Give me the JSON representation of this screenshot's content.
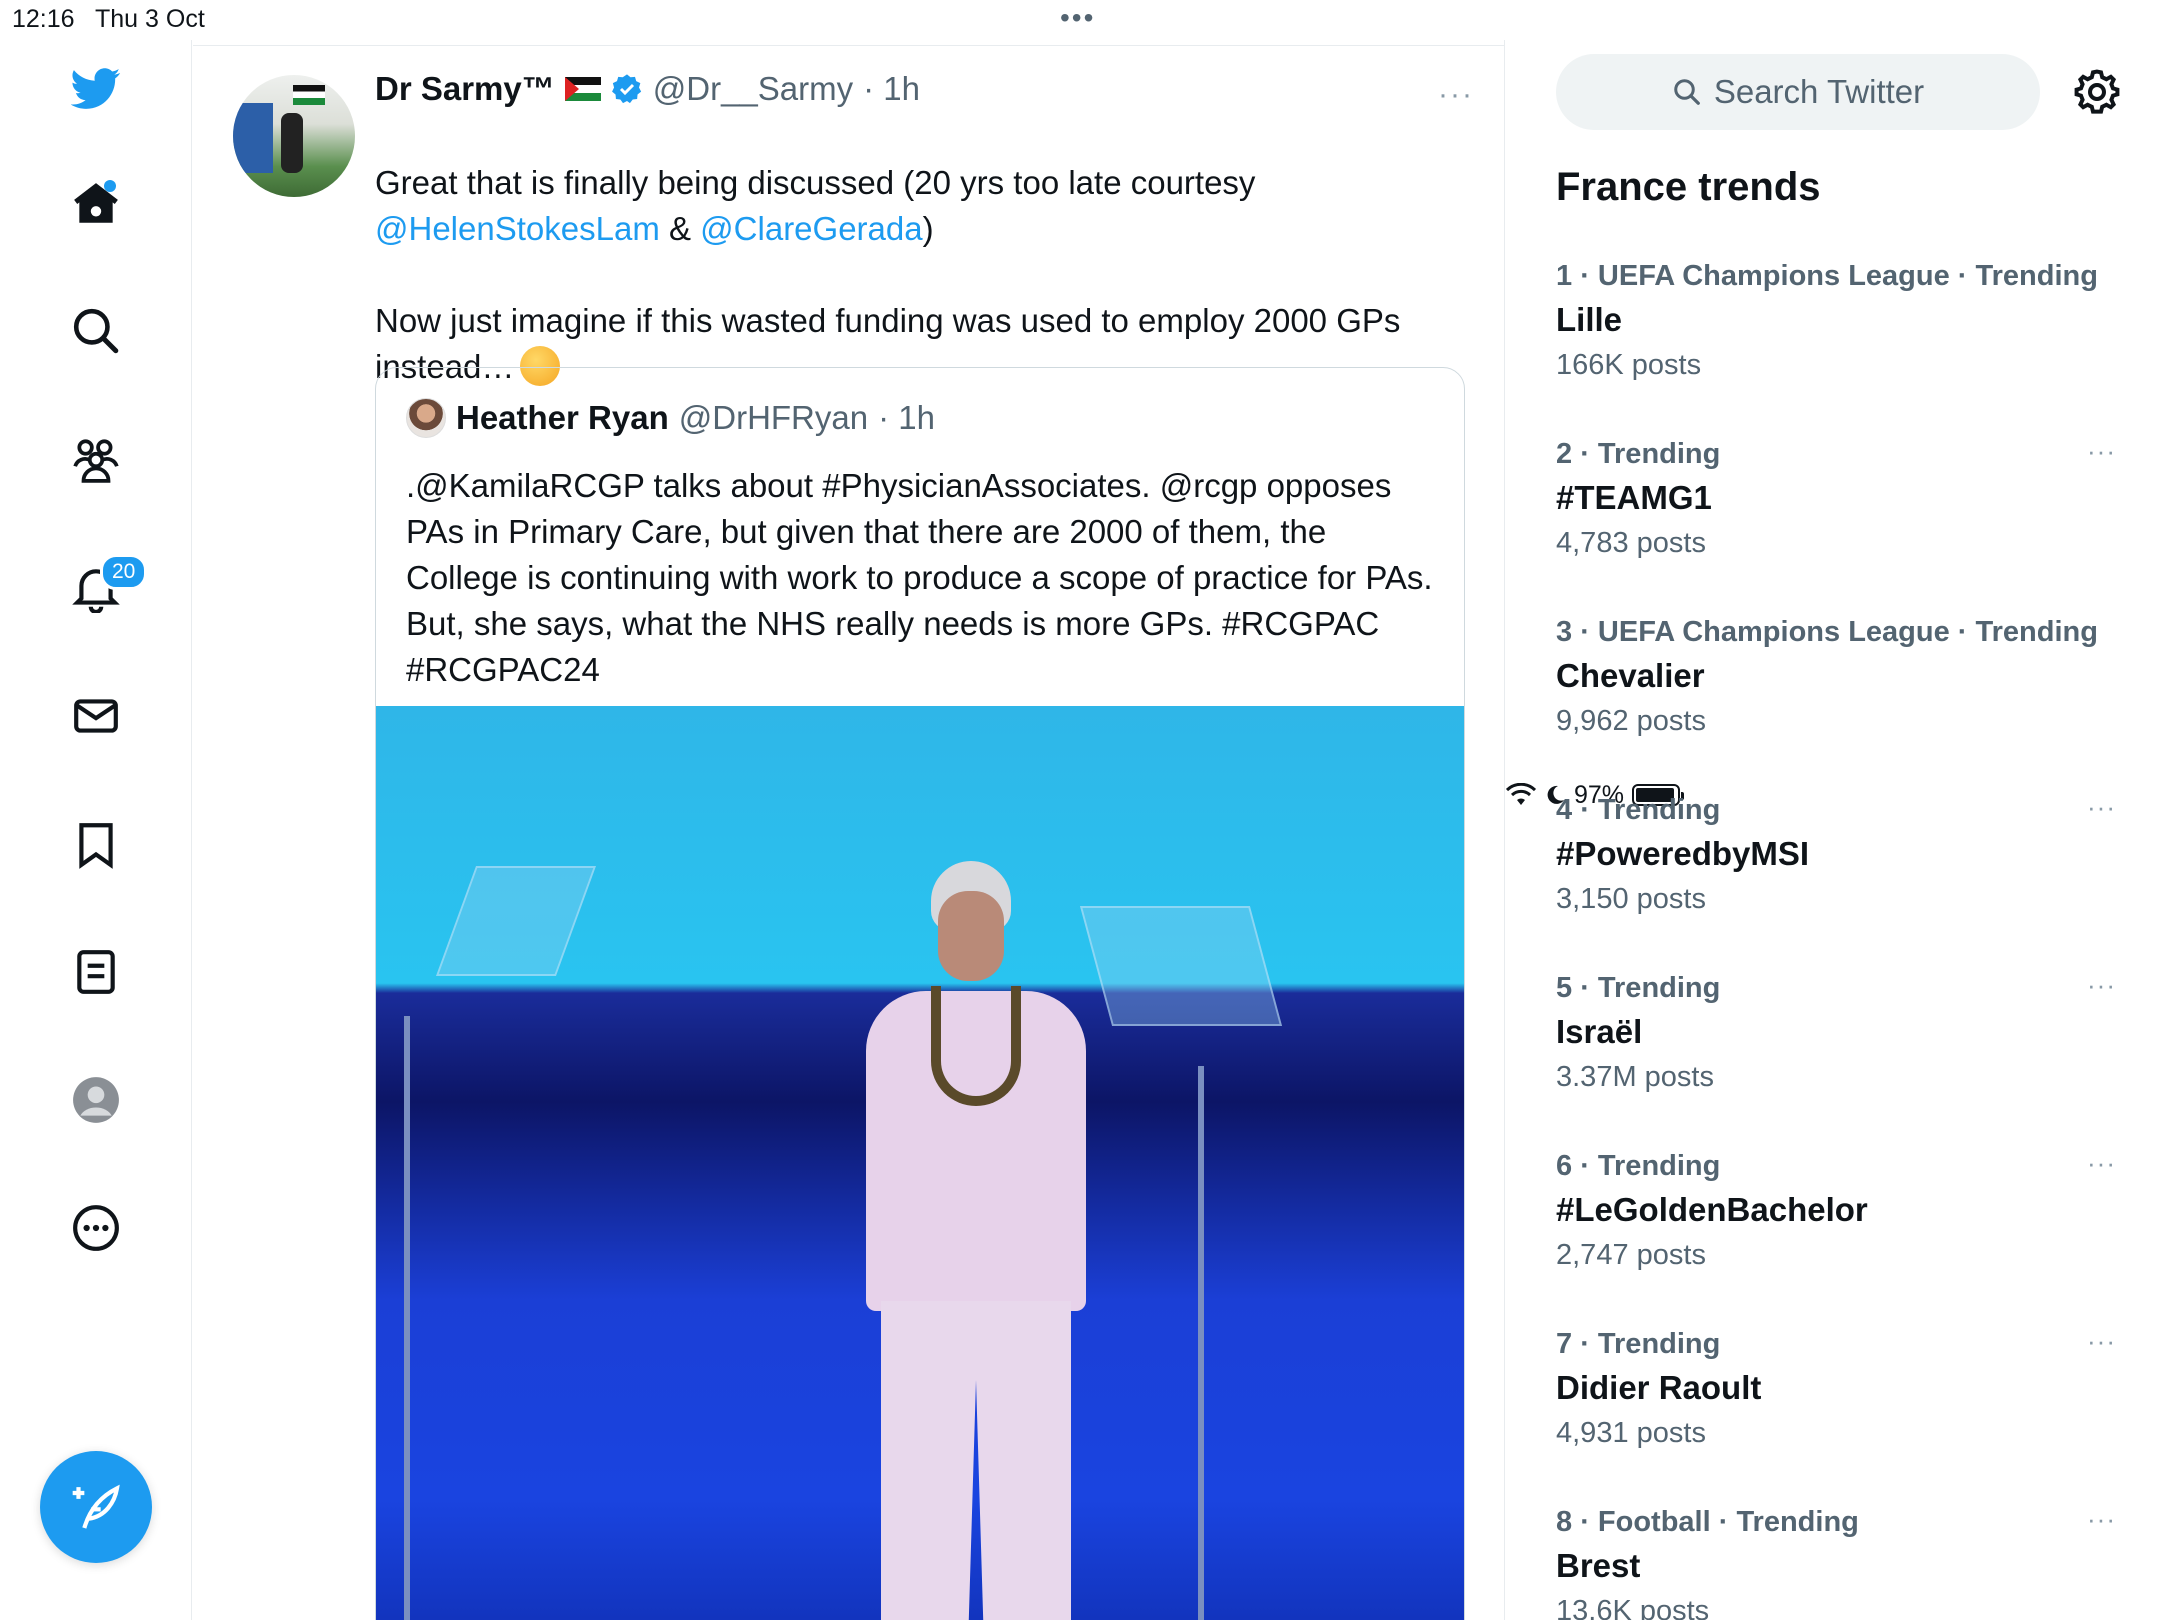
{
  "status_bar": {
    "time": "12:16",
    "date": "Thu 3 Oct",
    "battery": "97%",
    "battery_fraction": 0.97
  },
  "nav": {
    "notifications_badge": "20"
  },
  "tweet": {
    "author_name": "Dr Sarmy™",
    "handle": "@Dr__Sarmy",
    "time": "· 1h",
    "text_1": "Great that is finally being discussed (20 yrs too late courtesy",
    "mention_1": "@HelenStokesLam",
    "amp": " & ",
    "mention_2": "@ClareGerada",
    "close_paren": ")",
    "text_2": "Now just imagine if this wasted funding was used to employ 2000 GPs instead…",
    "more": "···"
  },
  "quoted_tweet": {
    "author_name": "Heather Ryan",
    "handle": "@DrHFRyan",
    "time": "· 1h",
    "text": ".@KamilaRCGP talks about #PhysicianAssociates. @rcgp opposes PAs in Primary Care, but given that there are 2000 of them, the College is continuing with work to produce a scope of practice for PAs. But, she says, what the NHS really needs is more GPs. #RCGPAC #RCGPAC24"
  },
  "sidebar": {
    "search_placeholder": "Search Twitter",
    "trends_title": "France trends",
    "trends": [
      {
        "rank": "1",
        "category": " · UEFA Champions League · Trending",
        "name": "Lille",
        "posts": "166K posts"
      },
      {
        "rank": "2",
        "category": " · Trending",
        "name": "#TEAMG1",
        "posts": "4,783 posts"
      },
      {
        "rank": "3",
        "category": " · UEFA Champions League · Trending",
        "name": "Chevalier",
        "posts": "9,962 posts"
      },
      {
        "rank": "4",
        "category": " · Trending",
        "name": "#PoweredbyMSI",
        "posts": "3,150 posts"
      },
      {
        "rank": "5",
        "category": " · Trending",
        "name": "Israël",
        "posts": "3.37M posts"
      },
      {
        "rank": "6",
        "category": " · Trending",
        "name": "#LeGoldenBachelor",
        "posts": "2,747 posts"
      },
      {
        "rank": "7",
        "category": " · Trending",
        "name": "Didier Raoult",
        "posts": "4,931 posts"
      },
      {
        "rank": "8",
        "category": " · Football · Trending",
        "name": "Brest",
        "posts": "13.6K posts"
      }
    ],
    "trend_more": "···"
  },
  "colors": {
    "accent": "#1d9bf0",
    "text": "#0f1419",
    "muted": "#536471"
  }
}
